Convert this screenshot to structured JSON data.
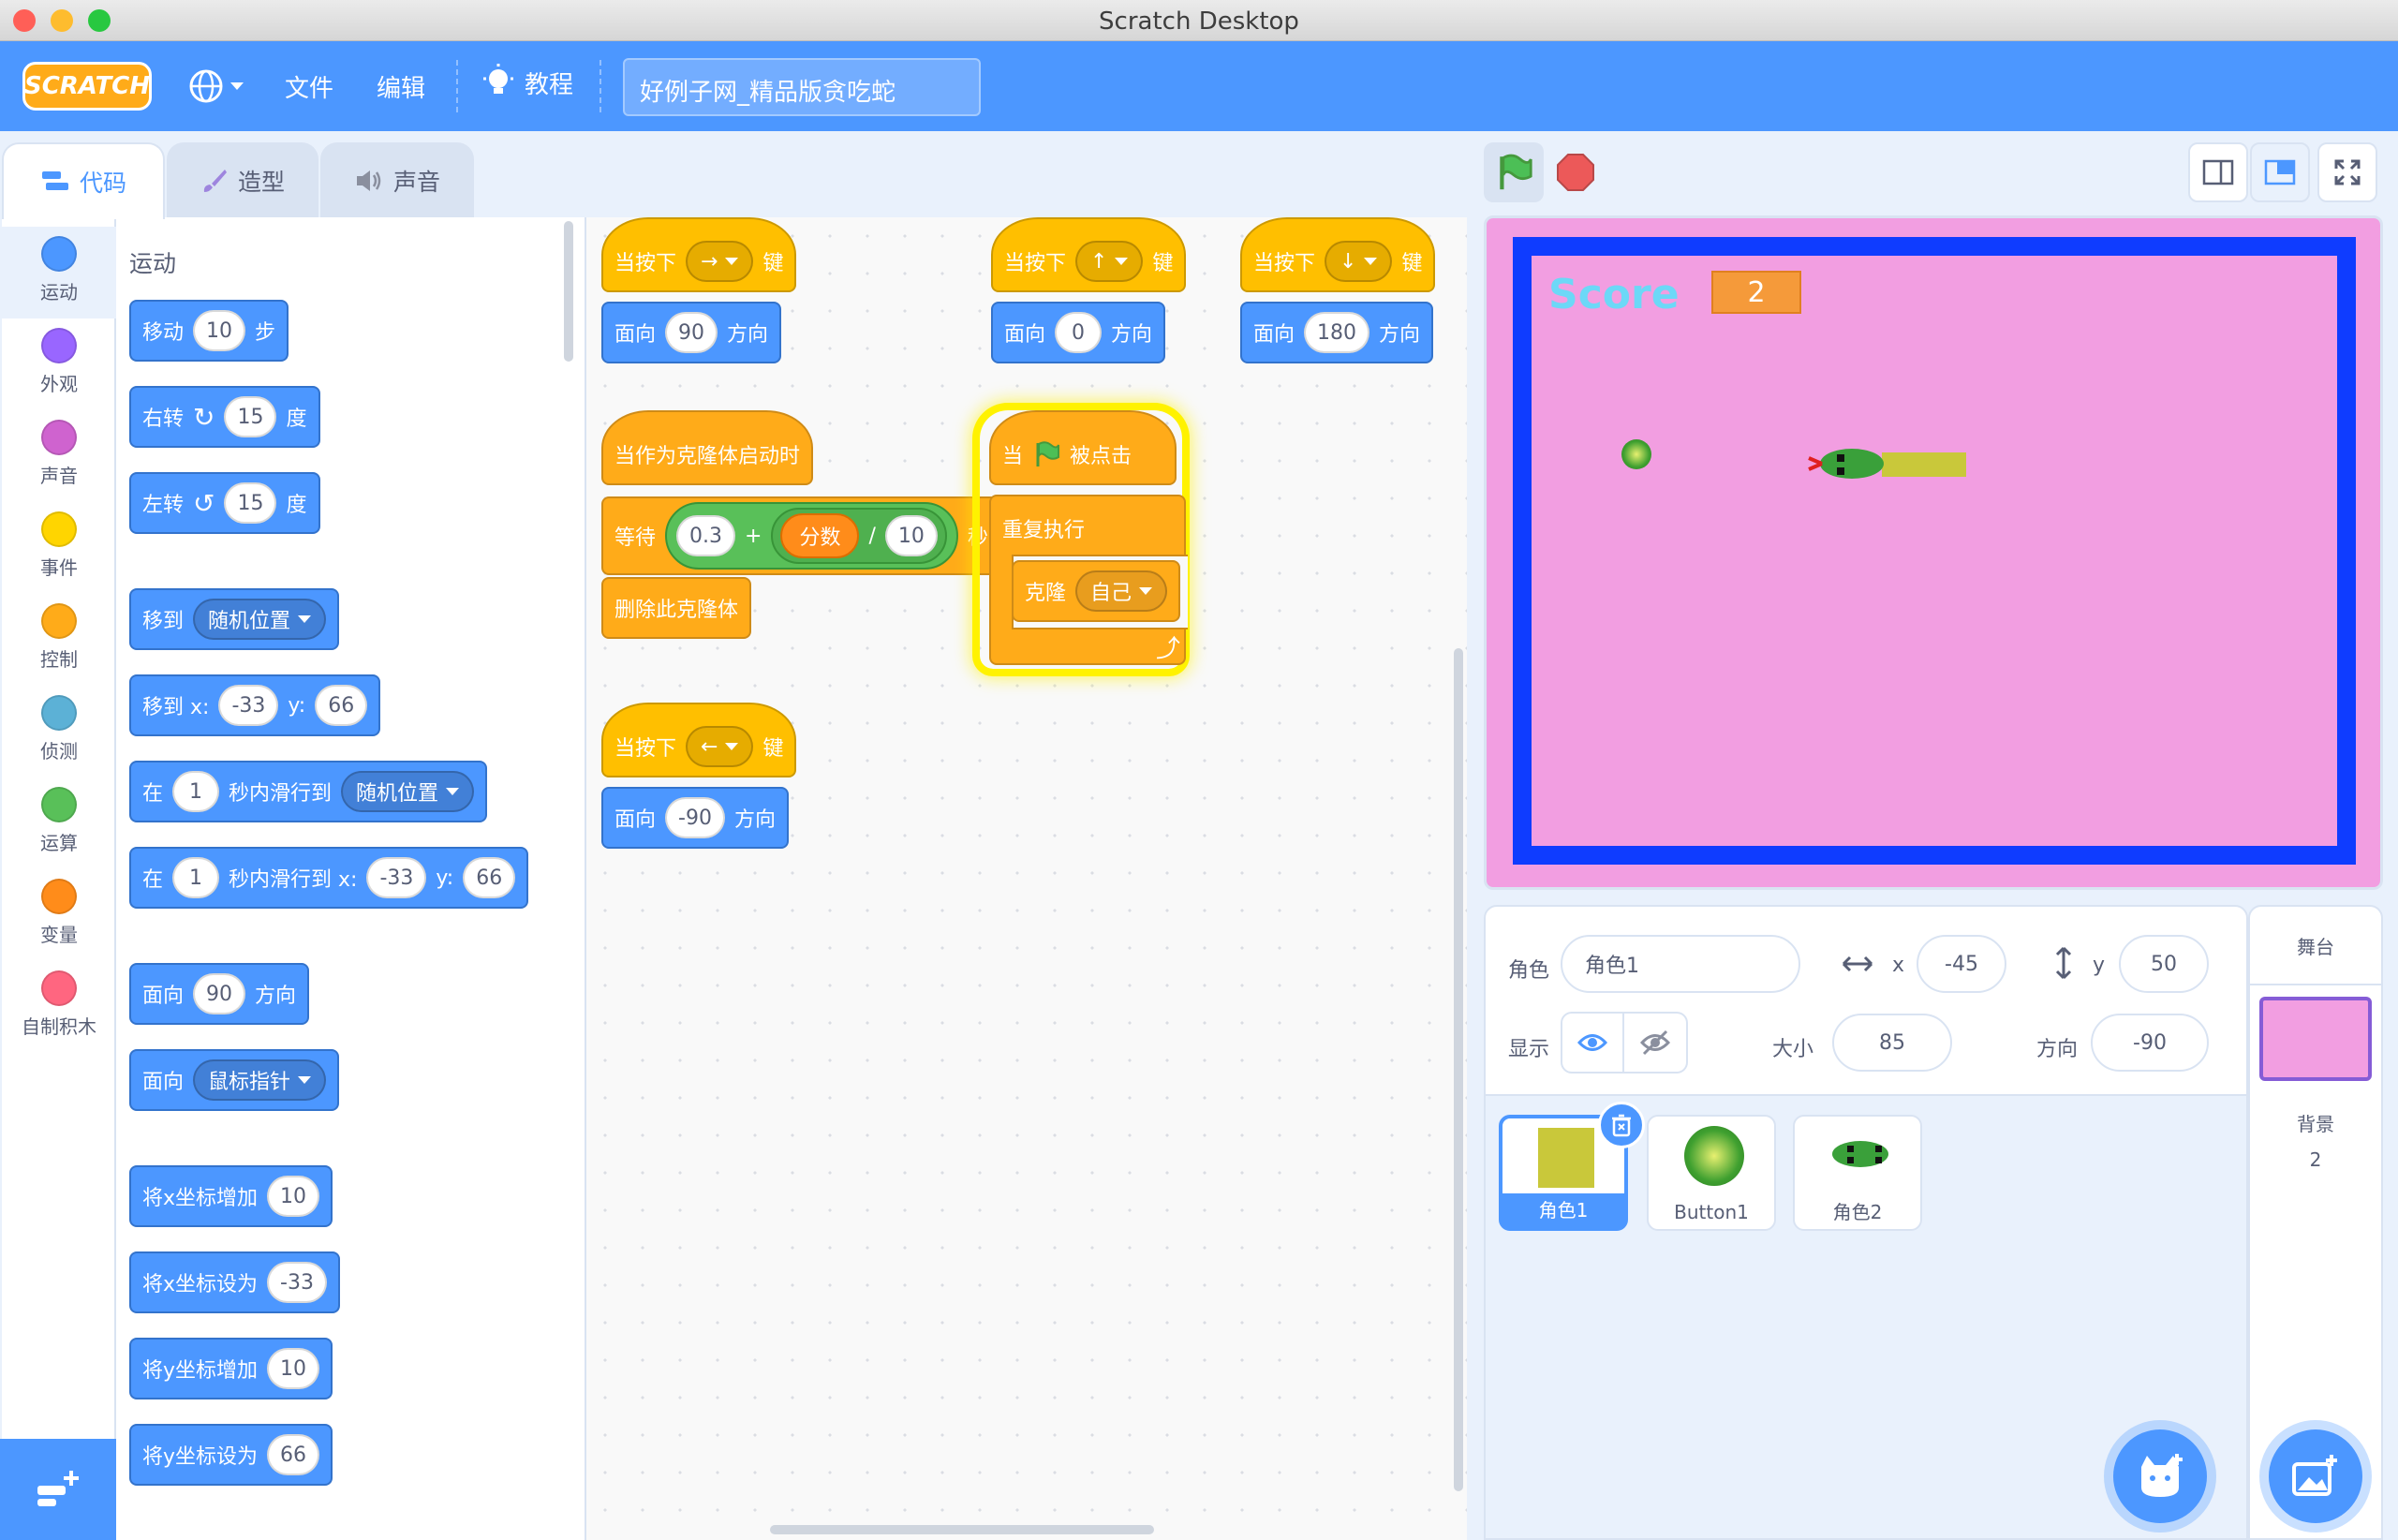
{
  "window": {
    "title": "Scratch Desktop"
  },
  "menu": {
    "logo": "SCRATCH",
    "file": "文件",
    "edit": "编辑",
    "tutorials": "教程",
    "project_title": "好例子网_精品版贪吃蛇"
  },
  "tabs": [
    {
      "label": "代码"
    },
    {
      "label": "造型"
    },
    {
      "label": "声音"
    }
  ],
  "categories": [
    {
      "label": "运动",
      "color": "#4c97ff"
    },
    {
      "label": "外观",
      "color": "#9966ff"
    },
    {
      "label": "声音",
      "color": "#cf63cf"
    },
    {
      "label": "事件",
      "color": "#ffd500"
    },
    {
      "label": "控制",
      "color": "#ffab19"
    },
    {
      "label": "侦测",
      "color": "#5cb1d6"
    },
    {
      "label": "运算",
      "color": "#59c059"
    },
    {
      "label": "变量",
      "color": "#ff8c1a"
    },
    {
      "label": "自制积木",
      "color": "#ff6680"
    }
  ],
  "palette": {
    "heading": "运动",
    "move": {
      "a": "移动",
      "v": "10",
      "b": "步"
    },
    "turn_right": {
      "a": "右转",
      "v": "15",
      "b": "度"
    },
    "turn_left": {
      "a": "左转",
      "v": "15",
      "b": "度"
    },
    "goto": {
      "a": "移到",
      "dd": "随机位置"
    },
    "goto_xy": {
      "a": "移到 x:",
      "x": "-33",
      "yl": "y:",
      "y": "66"
    },
    "glide": {
      "a": "在",
      "v": "1",
      "b": "秒内滑行到",
      "dd": "随机位置"
    },
    "glide_xy": {
      "a": "在",
      "v": "1",
      "b": "秒内滑行到 x:",
      "x": "-33",
      "yl": "y:",
      "y": "66"
    },
    "point": {
      "a": "面向",
      "v": "90",
      "b": "方向"
    },
    "point_towards": {
      "a": "面向",
      "dd": "鼠标指针"
    },
    "change_x": {
      "a": "将x坐标增加",
      "v": "10"
    },
    "set_x": {
      "a": "将x坐标设为",
      "v": "-33"
    },
    "change_y": {
      "a": "将y坐标增加",
      "v": "10"
    },
    "set_y": {
      "a": "将y坐标设为",
      "v": "66"
    }
  },
  "scripts": {
    "right": {
      "hat": "当按下",
      "key": "→",
      "keyword": "键",
      "face": "面向",
      "deg": "90",
      "dir": "方向"
    },
    "up": {
      "hat": "当按下",
      "key": "↑",
      "keyword": "键",
      "face": "面向",
      "deg": "0",
      "dir": "方向"
    },
    "down": {
      "hat": "当按下",
      "key": "↓",
      "keyword": "键",
      "face": "面向",
      "deg": "180",
      "dir": "方向"
    },
    "left": {
      "hat": "当按下",
      "key": "←",
      "keyword": "键",
      "face": "面向",
      "deg": "-90",
      "dir": "方向"
    },
    "clone": {
      "hat": "当作为克隆体启动时",
      "wait": "等待",
      "a": "0.3",
      "plus": "+",
      "var": "分数",
      "div": "/",
      "b": "10",
      "sec": "秒",
      "del": "删除此克隆体"
    },
    "flag": {
      "a": "当",
      "b": "被点击",
      "loop": "重复执行",
      "clone": "克隆",
      "self": "自己"
    }
  },
  "stage": {
    "score_label": "Score",
    "score_value": "2",
    "bg": "#f29ee1",
    "border": "#0f3cff"
  },
  "sprite_info": {
    "sprite_label": "角色",
    "sprite_name": "角色1",
    "x_label": "x",
    "x": "-45",
    "y_label": "y",
    "y": "50",
    "show_label": "显示",
    "size_label": "大小",
    "size": "85",
    "dir_label": "方向",
    "dir": "-90"
  },
  "sprites": [
    {
      "name": "角色1"
    },
    {
      "name": "Button1"
    },
    {
      "name": "角色2"
    }
  ],
  "stage_panel": {
    "title": "舞台",
    "backdrop_label": "背景",
    "backdrop_count": "2"
  }
}
